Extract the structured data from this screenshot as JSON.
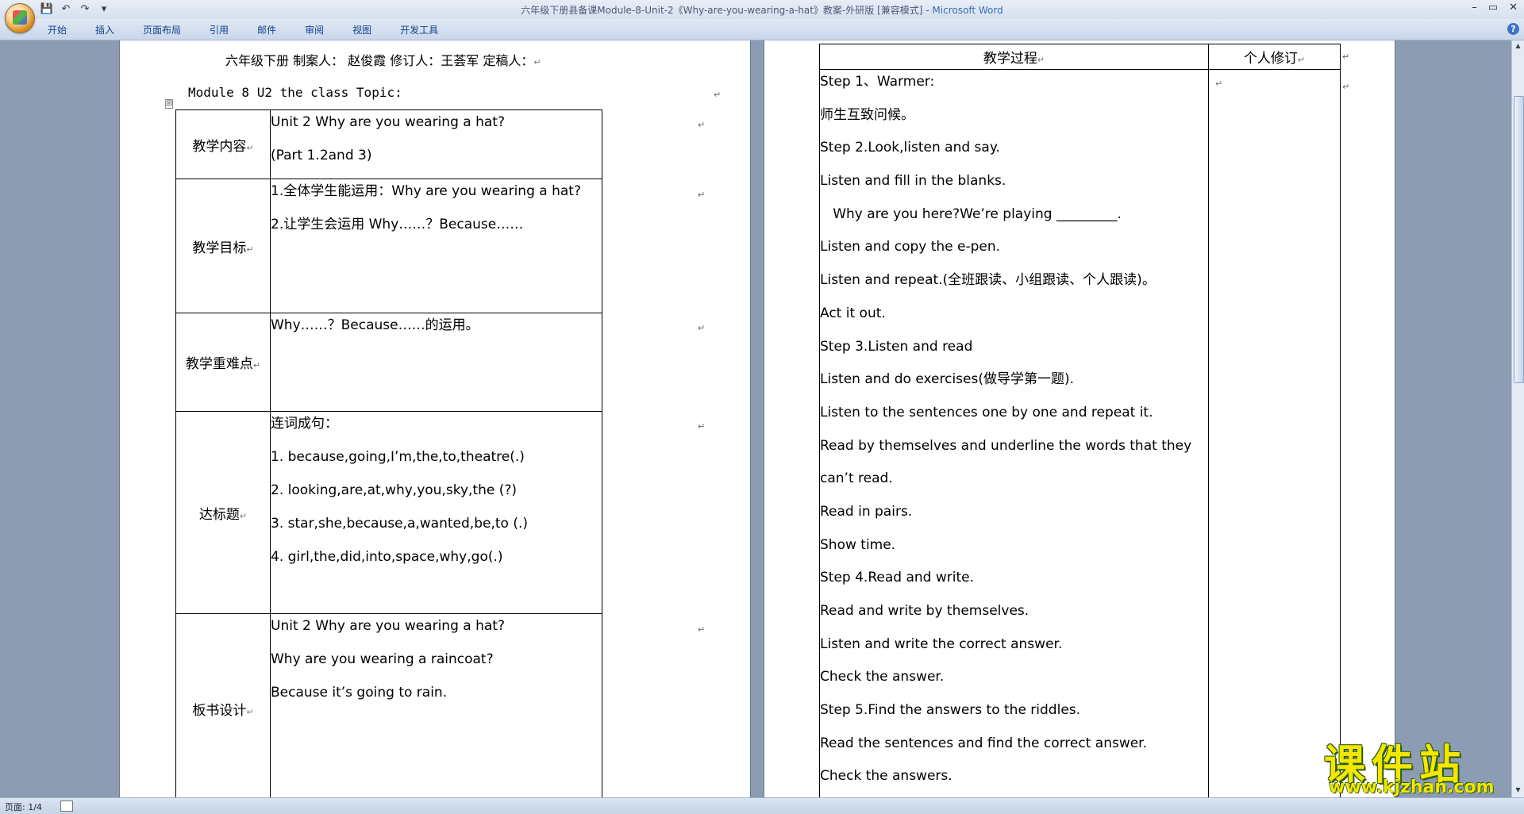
{
  "window": {
    "title": "六年级下册县备课Module-8-Unit-2《Why-are-you-wearing-a-hat》教案-外研版 [兼容模式]",
    "app_name": "Microsoft Word",
    "separator": " - "
  },
  "qat": {
    "save": "💾",
    "undo": "↶",
    "redo": "↷",
    "more": "▾"
  },
  "winctrl": {
    "min": "–",
    "max": "▭",
    "close": "✕"
  },
  "ribbon": {
    "tabs": [
      "开始",
      "插入",
      "页面布局",
      "引用",
      "邮件",
      "审阅",
      "视图",
      "开发工具"
    ],
    "help": "?"
  },
  "page1": {
    "header_line": "六年级下册   制案人：   赵俊霞     修订人：王荟军        定稿人：",
    "module_line": "Module 8 U2    the   class              Topic:",
    "rows": [
      {
        "label": "教学内容",
        "lines": [
          "Unit 2 Why are you wearing a hat?",
          "(Part 1.2and 3)"
        ]
      },
      {
        "label": "教学目标",
        "lines": [
          "1.全体学生能运用：Why are you wearing a hat?",
          "2.让学生会运用 Why……？Because……"
        ]
      },
      {
        "label": "教学重难点",
        "lines": [
          "Why……？Because……的运用。"
        ]
      },
      {
        "label": "达标题",
        "lines": [
          "连词成句：",
          "1. because,going,I’m,the,to,theatre(.)",
          "2. looking,are,at,why,you,sky,the (?)",
          "3. star,she,because,a,wanted,be,to (.)",
          "4. girl,the,did,into,space,why,go(.)"
        ]
      },
      {
        "label": "板书设计",
        "lines": [
          "Unit 2 Why are you wearing a hat?",
          "Why are you wearing a raincoat?",
          "Because it’s going to rain."
        ]
      }
    ]
  },
  "page2": {
    "col_process": "教学过程",
    "col_revision": "个人修订",
    "steps": [
      "Step 1、Warmer:",
      "师生互致问候。",
      "Step 2.Look,listen and say.",
      "Listen and fill in the blanks.",
      "   Why are you here?We’re playing _________.",
      "Listen and copy the e-pen.",
      "Listen and repeat.(全班跟读、小组跟读、个人跟读)。",
      "Act it out.",
      "Step 3.Listen and read",
      "Listen and do exercises(做导学第一题).",
      "Listen to the sentences one by one and repeat it.",
      "Read by themselves   and underline the words that they",
      "can’t read.",
      "Read in pairs.",
      "Show time.",
      "Step 4.Read    and write.",
      "Read and write by themselves.",
      "Listen and write the correct answer.",
      "Check the answer.",
      "Step 5.Find the answers to the riddles.",
      "Read the sentences and find the correct answer.",
      "Check the answers. "
    ]
  },
  "marks": {
    "para": "↵",
    "table_handle": "⊞",
    "scroll_up": "▲",
    "scroll_down": "▼"
  },
  "status": {
    "page": "页面: 1/4"
  },
  "watermark": {
    "main": "课件站",
    "url": "www.kjzhan.com"
  }
}
